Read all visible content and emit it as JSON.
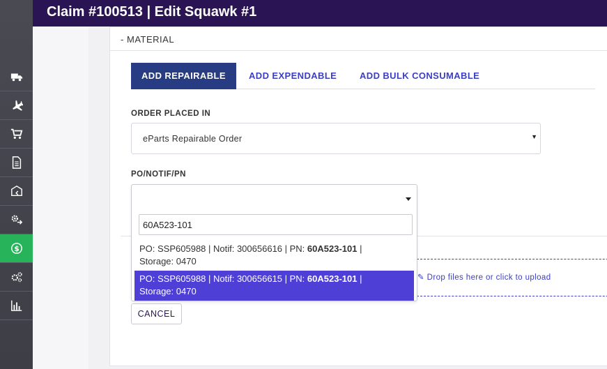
{
  "header": {
    "title": "Claim #100513 | Edit Squawk #1"
  },
  "sidebar": {
    "items": [
      {
        "icon": "truck-icon"
      },
      {
        "icon": "airplane-icon"
      },
      {
        "icon": "cart-icon"
      },
      {
        "icon": "document-icon"
      },
      {
        "icon": "box-return-icon"
      },
      {
        "icon": "gears-icon"
      },
      {
        "icon": "dollar-circle-icon",
        "active": true
      },
      {
        "icon": "cogs-icon"
      },
      {
        "icon": "bar-chart-icon"
      }
    ],
    "active_color": "#26b35a"
  },
  "section": {
    "toggle": "-",
    "title": "MATERIAL"
  },
  "tabs": [
    {
      "label": "ADD REPAIRABLE",
      "active": true
    },
    {
      "label": "ADD EXPENDABLE"
    },
    {
      "label": "ADD BULK CONSUMABLE"
    }
  ],
  "order_placed": {
    "label": "ORDER PLACED IN",
    "value": "eParts Repairable Order"
  },
  "po_field": {
    "label": "PO/NOTIF/PN",
    "search_value": "60A523-101",
    "options": [
      {
        "prefix": "PO: SSP605988 | Notif: 300656616 | PN: ",
        "pn": "60A523-101",
        "suffix": " |",
        "line2": "Storage: 0470",
        "highlighted": false
      },
      {
        "prefix": "PO: SSP605988 | Notif: 300656615 | PN: ",
        "pn": "60A523-101",
        "suffix": " |",
        "line2": "Storage: 0470",
        "highlighted": true
      }
    ]
  },
  "dropzone": {
    "icon": "paperclip-icon",
    "text": "✎ Drop files here or click to upload"
  },
  "cancel_label": "CANCEL",
  "colors": {
    "header": "#2a1454",
    "accent": "#3c3fc1",
    "tab_active": "#273c82",
    "highlight": "#4e3fd6"
  }
}
